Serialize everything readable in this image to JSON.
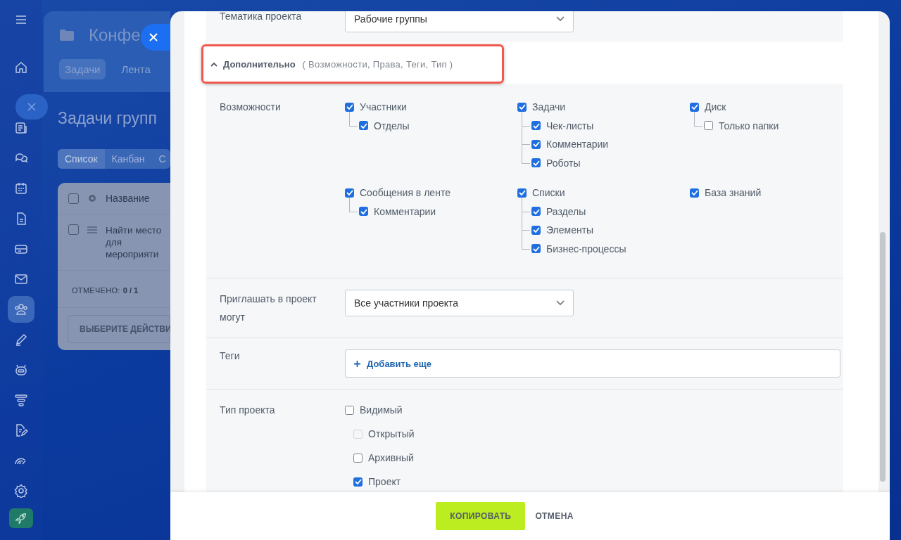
{
  "sidebar": {
    "items": [
      {
        "selected": false
      },
      {
        "selected": false
      },
      {
        "selected": false
      },
      {
        "selected": false
      },
      {
        "selected": false
      },
      {
        "selected": false
      },
      {
        "selected": false
      },
      {
        "selected": false
      },
      {
        "selected": true
      },
      {
        "selected": false
      },
      {
        "selected": false
      },
      {
        "selected": false
      },
      {
        "selected": false
      },
      {
        "selected": false
      },
      {
        "selected": false
      }
    ]
  },
  "background": {
    "title": "Конфе",
    "tabs": [
      {
        "label": "Задачи",
        "selected": true
      },
      {
        "label": "Лента",
        "selected": false
      }
    ],
    "heading": "Задачи групп",
    "view_tabs": [
      {
        "label": "Список",
        "selected": true
      },
      {
        "label": "Канбан",
        "selected": false
      },
      {
        "label": "С",
        "selected": false
      }
    ],
    "table": {
      "column": "Название",
      "header_checked": false,
      "rows": [
        {
          "checked": false,
          "title": [
            "Найти место",
            "для",
            "мероприяти"
          ]
        }
      ],
      "marked_label": "ОТМЕЧЕНО:",
      "marked_value": "0 / 1",
      "action": "ВЫБЕРИТЕ ДЕЙСТВИ"
    }
  },
  "panel": {
    "theme": {
      "label": "Тематика проекта",
      "value": "Рабочие группы"
    },
    "section": {
      "title": "Дополнительно",
      "hint": "( Возможности, Права, Теги, Тип )",
      "expanded": true
    },
    "features": {
      "label": "Возможности",
      "groups": [
        {
          "label": "Участники",
          "checked": true,
          "children": [
            {
              "label": "Отделы",
              "checked": true
            }
          ]
        },
        {
          "label": "Задачи",
          "checked": true,
          "children": [
            {
              "label": "Чек-листы",
              "checked": true
            },
            {
              "label": "Комментарии",
              "checked": true
            },
            {
              "label": "Роботы",
              "checked": true
            }
          ]
        },
        {
          "label": "Диск",
          "checked": true,
          "children": [
            {
              "label": "Только папки",
              "checked": false
            }
          ]
        },
        {
          "label": "Сообщения в ленте",
          "checked": true,
          "children": [
            {
              "label": "Комментарии",
              "checked": true
            }
          ]
        },
        {
          "label": "Списки",
          "checked": true,
          "children": [
            {
              "label": "Разделы",
              "checked": true
            },
            {
              "label": "Элементы",
              "checked": true
            },
            {
              "label": "Бизнес-процессы",
              "checked": true
            }
          ]
        },
        {
          "label": "База знаний",
          "checked": true
        }
      ]
    },
    "invite": {
      "label": "Приглашать в проект могут",
      "value": "Все участники проекта"
    },
    "tags": {
      "label": "Теги",
      "add": "Добавить еще"
    },
    "project_type": {
      "label": "Тип проекта",
      "options": [
        {
          "label": "Видимый",
          "checked": false,
          "disabled": false,
          "kind": "main"
        },
        {
          "label": "Открытый",
          "checked": false,
          "disabled": true,
          "kind": "sub"
        },
        {
          "label": "Архивный",
          "checked": false,
          "disabled": false,
          "kind": "sub"
        },
        {
          "label": "Проект",
          "checked": true,
          "disabled": false,
          "kind": "sub"
        }
      ]
    }
  },
  "footer": {
    "copy": "КОПИРОВАТЬ",
    "cancel": "ОТМЕНА"
  }
}
